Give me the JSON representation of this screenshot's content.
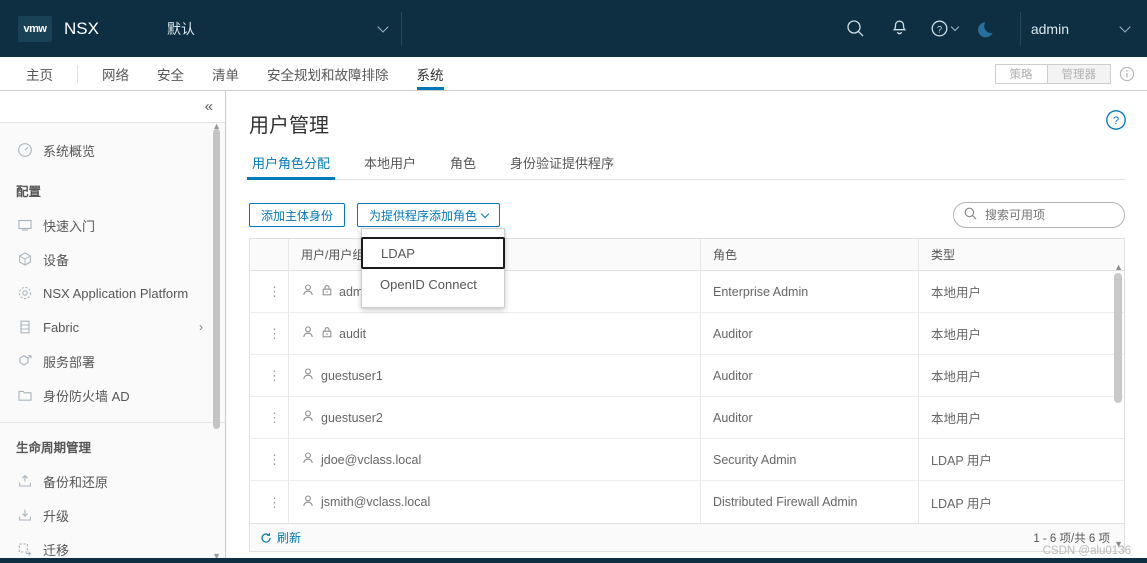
{
  "topbar": {
    "logo_text": "vmw",
    "app_name": "NSX",
    "tenant": "默认",
    "icons": [
      "search-icon",
      "bell-icon",
      "help-icon",
      "dark-mode-icon"
    ],
    "user": "admin",
    "bg_color": "#0e2e41"
  },
  "navbar": {
    "items": [
      {
        "label": "主页",
        "active": false
      },
      {
        "label": "网络",
        "active": false
      },
      {
        "label": "安全",
        "active": false
      },
      {
        "label": "清单",
        "active": false
      },
      {
        "label": "安全规划和故障排除",
        "active": false
      },
      {
        "label": "系统",
        "active": true
      }
    ],
    "mode_buttons": [
      "策略",
      "管理器"
    ],
    "accent_color": "#0079b8"
  },
  "sidebar": {
    "collapse_icon": "«",
    "overview": {
      "label": "系统概览",
      "icon": "gauge-icon"
    },
    "group_config_title": "配置",
    "config_items": [
      {
        "label": "快速入门",
        "icon": "screen-icon",
        "arrow": ""
      },
      {
        "label": "设备",
        "icon": "cube-icon",
        "arrow": ""
      },
      {
        "label": "NSX Application Platform",
        "icon": "platform-icon",
        "arrow": ""
      },
      {
        "label": "Fabric",
        "icon": "rack-icon",
        "arrow": "›"
      },
      {
        "label": "服务部署",
        "icon": "deploy-icon",
        "arrow": ""
      },
      {
        "label": "身份防火墙 AD",
        "icon": "folder-icon",
        "arrow": ""
      }
    ],
    "group_lifecycle_title": "生命周期管理",
    "lifecycle_items": [
      {
        "label": "备份和还原",
        "icon": "backup-icon",
        "arrow": ""
      },
      {
        "label": "升级",
        "icon": "upgrade-icon",
        "arrow": ""
      },
      {
        "label": "迁移",
        "icon": "migrate-icon",
        "arrow": ""
      }
    ]
  },
  "main": {
    "page_title": "用户管理",
    "help_icon": "help-circle-icon",
    "tabs": [
      {
        "label": "用户角色分配",
        "active": true
      },
      {
        "label": "本地用户",
        "active": false
      },
      {
        "label": "角色",
        "active": false
      },
      {
        "label": "身份验证提供程序",
        "active": false
      }
    ],
    "toolbar": {
      "add_principal_label": "添加主体身份",
      "add_role_label": "为提供程序添加角色"
    },
    "dropdown": {
      "open": true,
      "items": [
        {
          "label": "LDAP",
          "focused": true
        },
        {
          "label": "OpenID Connect",
          "focused": false
        }
      ]
    },
    "search": {
      "placeholder": "搜索可用项",
      "value": "",
      "icon": "search-icon"
    },
    "table": {
      "columns": [
        "用户/用户组",
        "角色",
        "类型"
      ],
      "rows": [
        {
          "user": "admin",
          "locked": true,
          "role": "Enterprise Admin",
          "type": "本地用户"
        },
        {
          "user": "audit",
          "locked": true,
          "role": "Auditor",
          "type": "本地用户"
        },
        {
          "user": "guestuser1",
          "locked": false,
          "role": "Auditor",
          "type": "本地用户"
        },
        {
          "user": "guestuser2",
          "locked": false,
          "role": "Auditor",
          "type": "本地用户"
        },
        {
          "user": "jdoe@vclass.local",
          "locked": false,
          "role": "Security Admin",
          "type": "LDAP 用户"
        },
        {
          "user": "jsmith@vclass.local",
          "locked": false,
          "role": "Distributed Firewall Admin",
          "type": "LDAP 用户"
        }
      ],
      "footer": {
        "refresh_label": "刷新",
        "page_count": "1 - 6 项/共 6 项"
      }
    }
  },
  "watermark": "CSDN @alu0136"
}
